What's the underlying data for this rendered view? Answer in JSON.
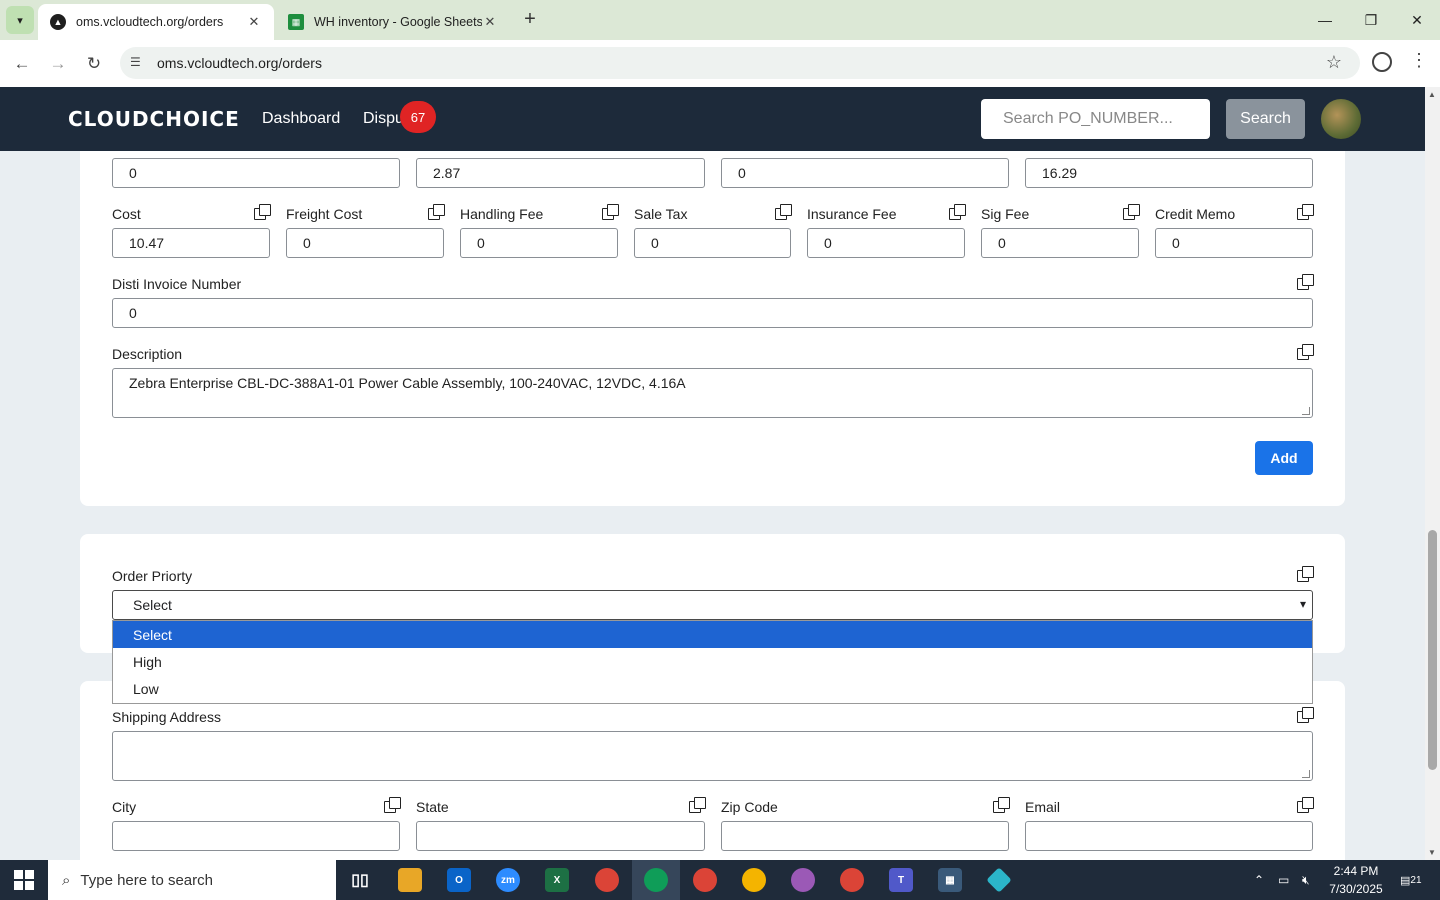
{
  "browser": {
    "tabs": [
      {
        "title": "oms.vcloudtech.org/orders",
        "icon": "oms-favicon-icon"
      },
      {
        "title": "WH inventory - Google Sheets",
        "icon": "google-sheets-icon"
      }
    ],
    "url": "oms.vcloudtech.org/orders"
  },
  "navbar": {
    "logo": "CLOUDCHOICE",
    "links": [
      "Dashboard",
      "Dispu"
    ],
    "dispute_badge": "67",
    "search_placeholder": "Search PO_NUMBER...",
    "search_button": "Search"
  },
  "form": {
    "top_row_values": [
      "0",
      "2.87",
      "0",
      "16.29"
    ],
    "fees": [
      {
        "label": "Cost",
        "value": "10.47"
      },
      {
        "label": "Freight Cost",
        "value": "0"
      },
      {
        "label": "Handling Fee",
        "value": "0"
      },
      {
        "label": "Sale Tax",
        "value": "0"
      },
      {
        "label": "Insurance Fee",
        "value": "0"
      },
      {
        "label": "Sig Fee",
        "value": "0"
      },
      {
        "label": "Credit Memo",
        "value": "0"
      }
    ],
    "disti_invoice": {
      "label": "Disti Invoice Number",
      "value": "0"
    },
    "description": {
      "label": "Description",
      "value": "Zebra Enterprise CBL-DC-388A1-01 Power Cable Assembly, 100-240VAC, 12VDC, 4.16A"
    },
    "add_button": "Add"
  },
  "priority": {
    "label": "Order Priorty",
    "selected": "Select",
    "options": [
      "Select",
      "High",
      "Low"
    ]
  },
  "shipping": {
    "address_label": "Shipping Address",
    "city_label": "City",
    "state_label": "State",
    "zip_label": "Zip Code",
    "email_label": "Email"
  },
  "taskbar": {
    "search_placeholder": "Type here to search",
    "time": "2:44 PM",
    "date": "7/30/2025",
    "notification_count": "21"
  },
  "colors": {
    "navbar": "#1d2a3a",
    "accent": "#1a73e8",
    "badge": "#e02424"
  }
}
